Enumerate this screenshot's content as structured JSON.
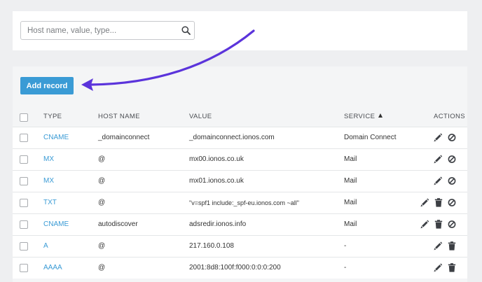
{
  "search": {
    "placeholder": "Host name, value, type..."
  },
  "toolbar": {
    "add_record_label": "Add record"
  },
  "columns": {
    "type": "TYPE",
    "host": "HOST NAME",
    "value": "VALUE",
    "service": "SERVICE",
    "actions": "ACTIONS"
  },
  "sort": {
    "column": "service",
    "direction": "ascending"
  },
  "rows": [
    {
      "type": "CNAME",
      "host": "_domainconnect",
      "value": "_domainconnect.ionos.com",
      "service": "Domain Connect",
      "actions": [
        "edit",
        "disable"
      ]
    },
    {
      "type": "MX",
      "host": "@",
      "value": "mx00.ionos.co.uk",
      "service": "Mail",
      "actions": [
        "edit",
        "disable"
      ]
    },
    {
      "type": "MX",
      "host": "@",
      "value": "mx01.ionos.co.uk",
      "service": "Mail",
      "actions": [
        "edit",
        "disable"
      ]
    },
    {
      "type": "TXT",
      "host": "@",
      "value": "\"v=spf1 include:_spf-eu.ionos.com ~all\"",
      "service": "Mail",
      "actions": [
        "edit",
        "delete",
        "disable"
      ]
    },
    {
      "type": "CNAME",
      "host": "autodiscover",
      "value": "adsredir.ionos.info",
      "service": "Mail",
      "actions": [
        "edit",
        "delete",
        "disable"
      ]
    },
    {
      "type": "A",
      "host": "@",
      "value": "217.160.0.108",
      "service": "-",
      "actions": [
        "edit",
        "delete"
      ]
    },
    {
      "type": "AAAA",
      "host": "@",
      "value": "2001:8d8:100f:f000:0:0:0:200",
      "service": "-",
      "actions": [
        "edit",
        "delete"
      ]
    }
  ],
  "icons": {
    "search": "search-icon",
    "edit": "pencil-icon",
    "delete": "trash-icon",
    "disable": "block-icon",
    "sort": "sort-ascending-icon",
    "annotation": "curved-arrow-icon"
  },
  "colors": {
    "accent": "#3a9bd5",
    "annotation_arrow": "#5b34db",
    "page_background": "#eeeff1"
  }
}
